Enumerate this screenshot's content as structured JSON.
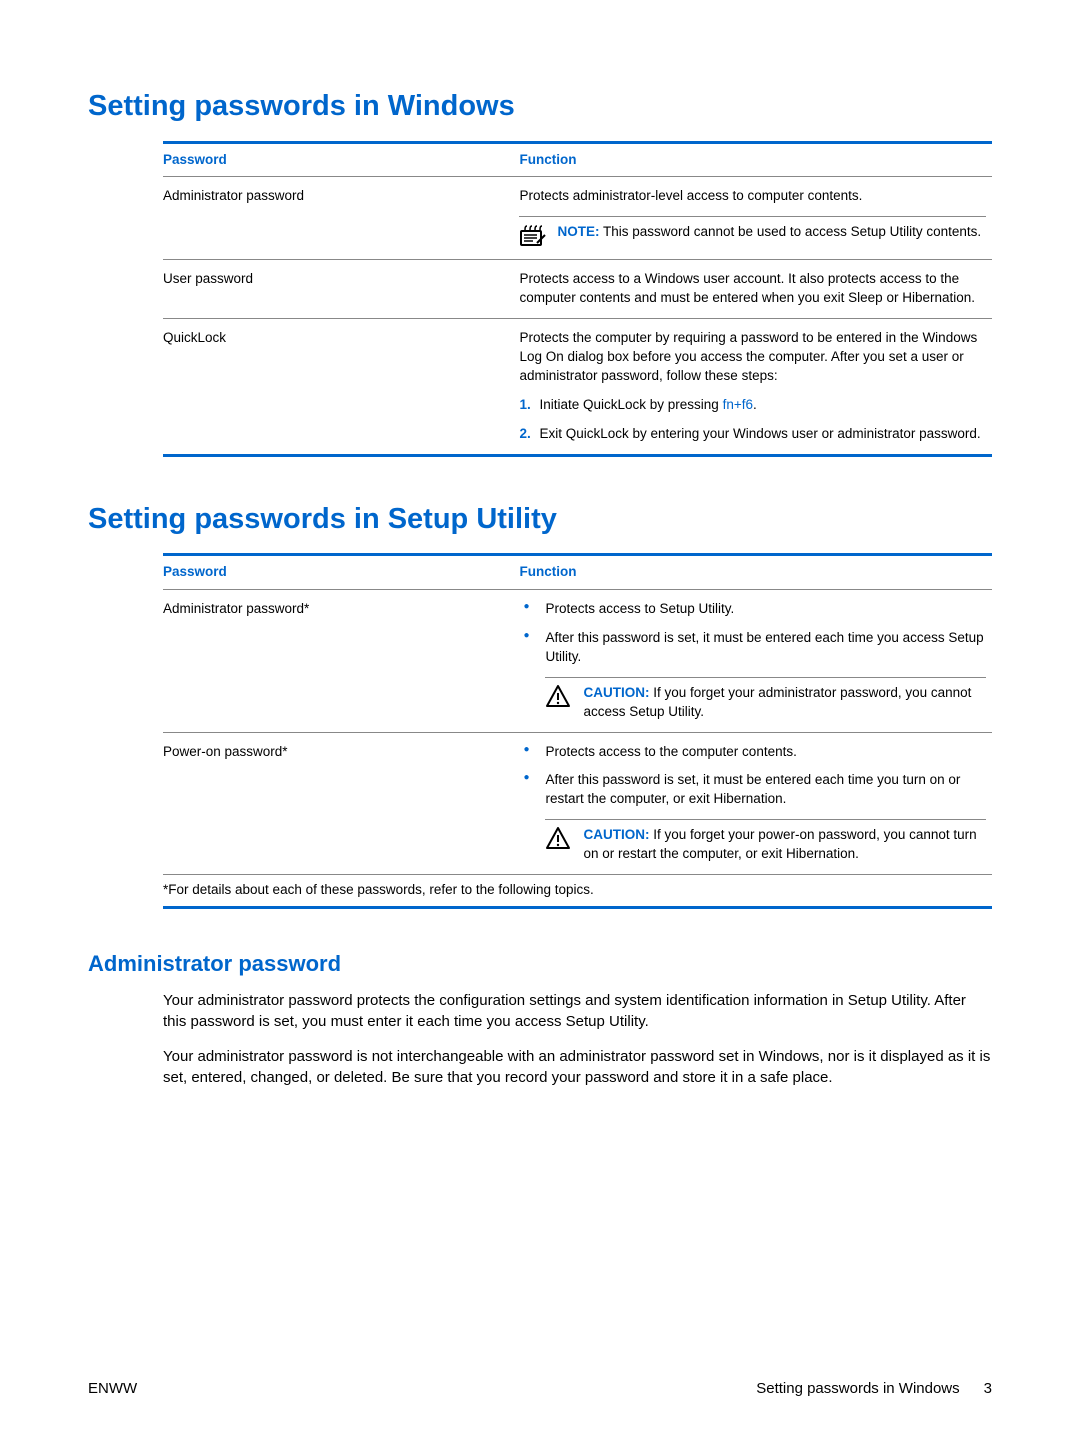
{
  "section1": {
    "heading": "Setting passwords in Windows",
    "th_password": "Password",
    "th_function": "Function",
    "row1": {
      "name": "Administrator password",
      "desc": "Protects administrator-level access to computer contents.",
      "note_label": "NOTE:",
      "note_text": "This password cannot be used to access Setup Utility contents."
    },
    "row2": {
      "name": "User password",
      "desc": "Protects access to a Windows user account. It also protects access to the computer contents and must be entered when you exit Sleep or Hibernation."
    },
    "row3": {
      "name": "QuickLock",
      "desc": "Protects the computer by requiring a password to be entered in the Windows Log On dialog box before you access the computer. After you set a user or administrator password, follow these steps:",
      "step1_num": "1.",
      "step1_a": "Initiate QuickLock by pressing ",
      "step1_key": "fn+f6",
      "step1_b": ".",
      "step2_num": "2.",
      "step2": "Exit QuickLock by entering your Windows user or administrator password."
    }
  },
  "section2": {
    "heading": "Setting passwords in Setup Utility",
    "th_password": "Password",
    "th_function": "Function",
    "row1": {
      "name": "Administrator password*",
      "b1": "Protects access to Setup Utility.",
      "b2": "After this password is set, it must be entered each time you access Setup Utility.",
      "caution_label": "CAUTION:",
      "caution_text": "If you forget your administrator password, you cannot access Setup Utility."
    },
    "row2": {
      "name": "Power-on password*",
      "b1": "Protects access to the computer contents.",
      "b2": "After this password is set, it must be entered each time you turn on or restart the computer, or exit Hibernation.",
      "caution_label": "CAUTION:",
      "caution_text": "If you forget your power-on password, you cannot turn on or restart the computer, or exit Hibernation."
    },
    "footnote": "*For details about each of these passwords, refer to the following topics."
  },
  "section3": {
    "heading": "Administrator password",
    "p1": "Your administrator password protects the configuration settings and system identification information in Setup Utility. After this password is set, you must enter it each time you access Setup Utility.",
    "p2": "Your administrator password is not interchangeable with an administrator password set in Windows, nor is it displayed as it is set, entered, changed, or deleted. Be sure that you record your password and store it in a safe place."
  },
  "footer": {
    "left": "ENWW",
    "right_text": "Setting passwords in Windows",
    "page_num": "3"
  }
}
